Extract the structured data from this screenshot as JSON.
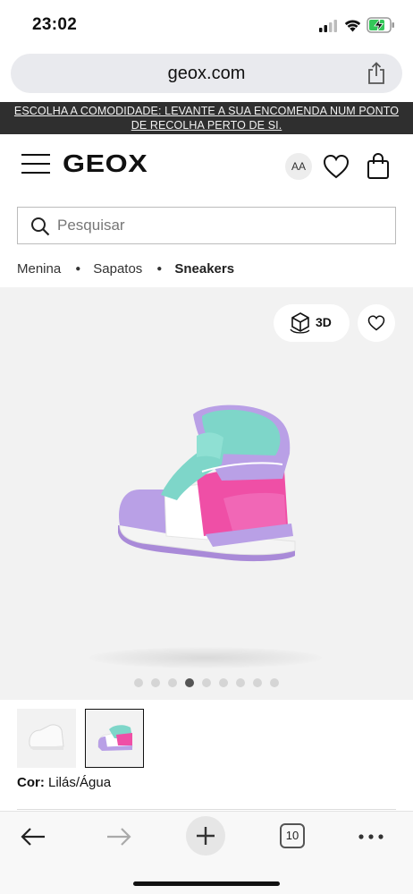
{
  "status_bar": {
    "time": "23:02"
  },
  "browser": {
    "url": "geox.com"
  },
  "promo_banner": {
    "text": "ESCOLHA A COMODIDADE: LEVANTE A SUA ENCOMENDA NUM PONTO DE RECOLHA PERTO DE SI."
  },
  "header": {
    "logo": "GEOX",
    "font_size_button": "AA"
  },
  "search": {
    "placeholder": "Pesquisar"
  },
  "breadcrumb": {
    "items": [
      "Menina",
      "Sapatos",
      "Sneakers"
    ]
  },
  "product": {
    "view_3d_label": "3D",
    "gallery": {
      "total_images": 9,
      "active_index": 3
    },
    "color_label": "Cor:",
    "color_value": "Lilás/Água"
  },
  "toolbar": {
    "tab_count": "10"
  },
  "colors": {
    "banner_bg": "#2f2f2f",
    "lilac": "#b9a0e6",
    "aqua": "#7ed6c9",
    "pink": "#ef4fa6"
  }
}
